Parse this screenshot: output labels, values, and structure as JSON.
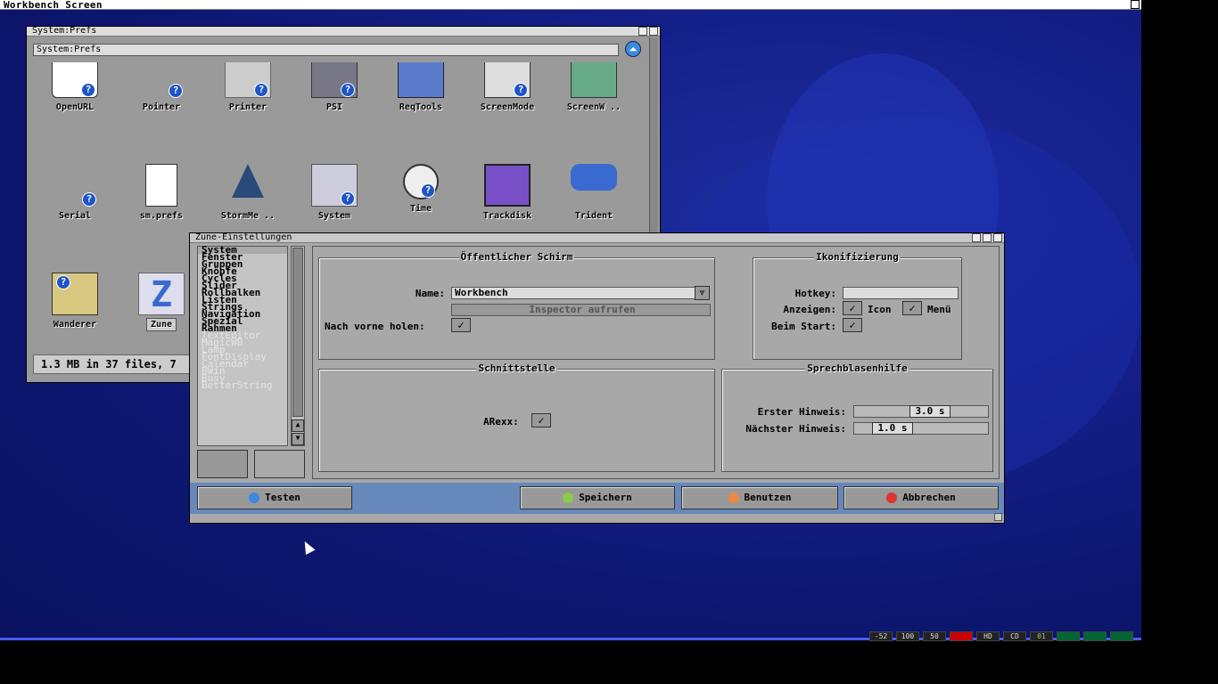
{
  "screen": {
    "title": "Workbench Screen"
  },
  "prefs_window": {
    "title": "System:Prefs",
    "path": "System:Prefs",
    "icons_row1": [
      "OpenURL",
      "Pointer",
      "Printer",
      "PSI",
      "ReqTools",
      "ScreenMode",
      "ScreenW .."
    ],
    "icons_row2": [
      "Serial",
      "sm.prefs",
      "StormMe ..",
      "System",
      "Time",
      "Trackdisk",
      "Trident"
    ],
    "icons_row3": [
      "Wanderer",
      "Zune"
    ],
    "status": "1.3 MB in 37 files, 7"
  },
  "zune_window": {
    "title": "Zune-Einstellungen",
    "categories": [
      "System",
      "Fenster",
      "Gruppen",
      "Knöpfe",
      "Cycles",
      "Slider",
      "Rollbalken",
      "Listen",
      "Strings",
      "Navigation",
      "Spezial",
      "Rahmen"
    ],
    "categories_disabled": [
      "TextEditor",
      "MagicWB",
      "Lamp",
      "FontDisplay",
      "Calendar",
      "BWin",
      "Busy",
      "BetterString"
    ],
    "public_screen": {
      "title": "Öffentlicher Schirm",
      "name_label": "Name:",
      "name_value": "Workbench",
      "inspector_button": "Inspector aufrufen",
      "front_label": "Nach vorne holen:"
    },
    "iconify": {
      "title": "Ikonifizierung",
      "hotkey_label": "Hotkey:",
      "show_label": "Anzeigen:",
      "icon_label": "Icon",
      "menu_label": "Menü",
      "start_label": "Beim Start:"
    },
    "interface": {
      "title": "Schnittstelle",
      "arexx_label": "ARexx:"
    },
    "bubble": {
      "title": "Sprechblasenhilfe",
      "first_label": "Erster Hinweis:",
      "first_value": "3.0 s",
      "next_label": "Nächster Hinweis:",
      "next_value": "1.0 s"
    },
    "buttons": {
      "test": "Testen",
      "save": "Speichern",
      "use": "Benutzen",
      "cancel": "Abbrechen"
    }
  },
  "indicators": [
    "-52",
    "100",
    "50",
    "",
    "HD",
    "CD",
    "01",
    "",
    "",
    ""
  ],
  "colors": {
    "desktop": "#14208a",
    "window": "#a8a8a8",
    "bottombar": "#6688bb"
  }
}
